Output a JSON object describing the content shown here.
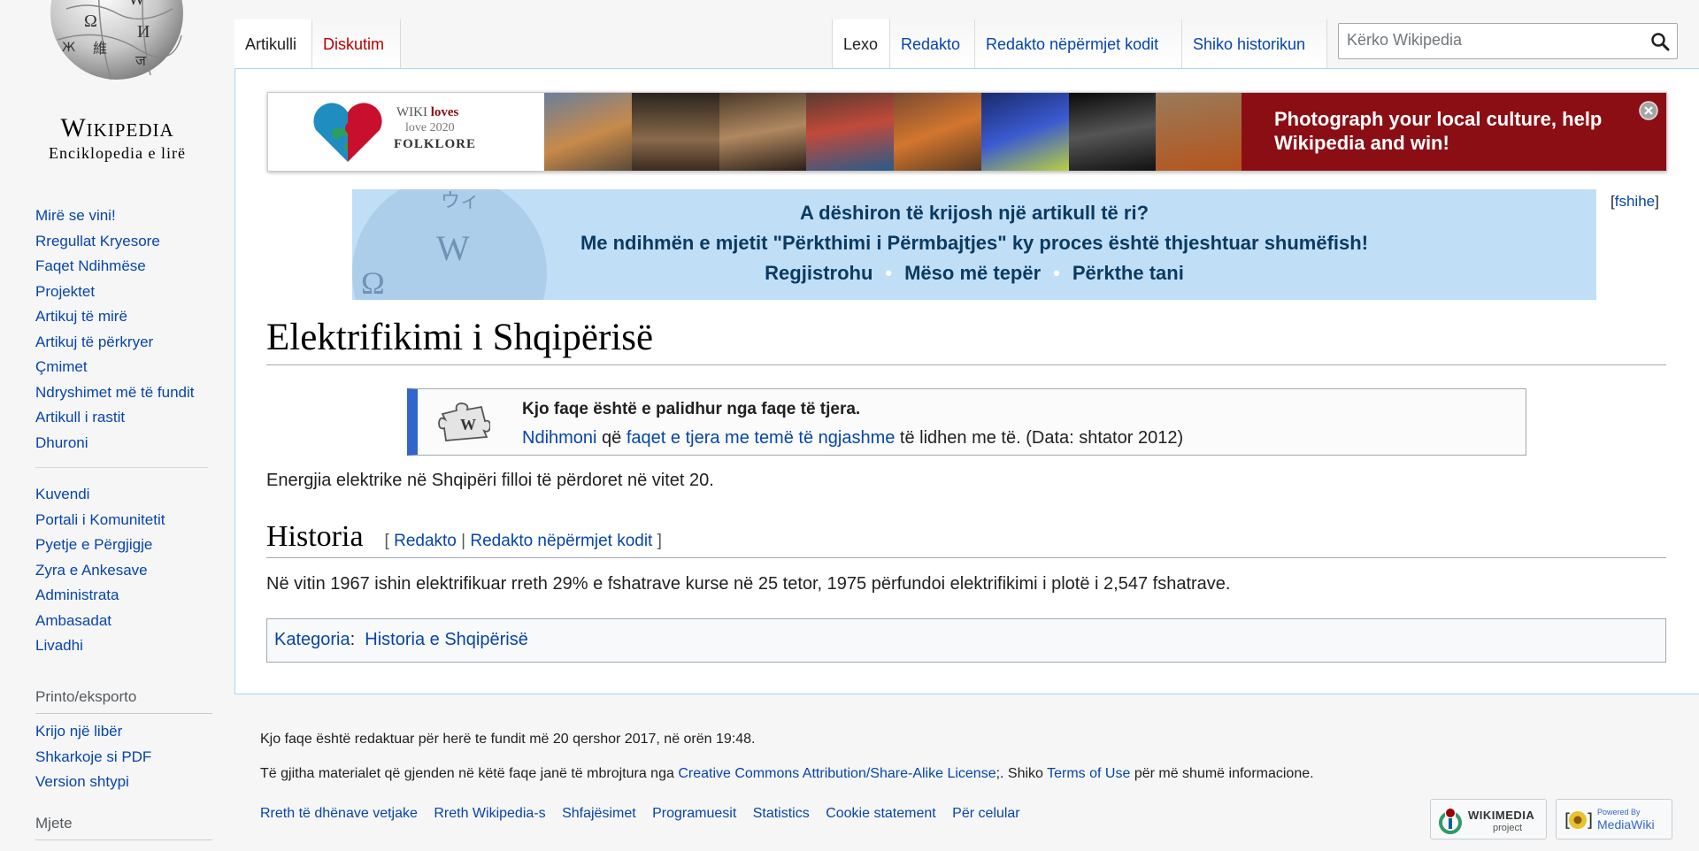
{
  "logo": {
    "wordmark": "Wikipedia",
    "tagline": "Enciklopedia e lirë"
  },
  "sidebar": {
    "nav": [
      "Mirë se vini!",
      "Rregullat Kryesore",
      "Faqet Ndihmëse",
      "Projektet",
      "Artikuj të mirë",
      "Artikuj të përkryer",
      "Çmimet",
      "Ndryshimet më të fundit",
      "Artikull i rastit",
      "Dhuroni"
    ],
    "community": [
      "Kuvendi",
      "Portali i Komunitetit",
      "Pyetje e Përgjigje",
      "Zyra e Ankesave",
      "Administrata",
      "Ambasadat",
      "Livadhi"
    ],
    "print_heading": "Printo/eksporto",
    "print": [
      "Krijo një libër",
      "Shkarkoje si PDF",
      "Version shtypi"
    ],
    "tools_heading": "Mjete"
  },
  "tabs": {
    "article": "Artikulli",
    "talk": "Diskutim",
    "read": "Lexo",
    "edit": "Redakto",
    "edit_source": "Redakto nëpërmjet kodit",
    "history": "Shiko historikun"
  },
  "search": {
    "placeholder": "Kërko Wikipedia"
  },
  "banner": {
    "wiki": "WIKI",
    "loves": "loves",
    "year": "love 2020",
    "folklore": "FOLKLORE",
    "line1": "Photograph your local culture, help",
    "line2": "Wikipedia and win!"
  },
  "cx": {
    "line1": "A dëshiron të krijosh një artikull të ri?",
    "line2": "Me ndihmën e mjetit \"Përkthimi i Përmbajtjes\" ky proces është thjeshtuar shumëfish!",
    "register": "Regjistrohu",
    "learn": "Mëso më tepër",
    "translate": "Përkthe tani",
    "hide": "fshihe"
  },
  "article": {
    "title": "Elektrifikimi i Shqipërisë",
    "orphan_title": "Kjo faqe është e palidhur nga faqe të tjera.",
    "orphan_help": "Ndihmoni",
    "orphan_mid": "që",
    "orphan_link": "faqet e tjera me temë të ngjashme",
    "orphan_end": "të lidhen me të. (Data: shtator 2012)",
    "intro": "Energjia elektrike në Shqipëri filloi të përdoret në vitet 20.",
    "section_title": "Historia",
    "section_edit": "Redakto",
    "section_edit_source": "Redakto nëpërmjet kodit",
    "history_text": "Në vitin 1967 ishin elektrifikuar rreth 29% e fshatrave kurse në 25 tetor, 1975 përfundoi elektrifikimi i plotë i 2,547 fshatrave.",
    "category_label": "Kategoria",
    "category": "Historia e Shqipërisë"
  },
  "footer": {
    "lastmod": "Kjo faqe është redaktuar për herë te fundit më 20 qershor 2017, në orën 19:48.",
    "license_pre": "Të gjitha materialet që gjenden në këtë faqe janë të mbrojtura nga",
    "license_link": "Creative Commons Attribution/Share-Alike License",
    "license_mid": ";. Shiko",
    "terms": "Terms of Use",
    "license_end": "për më shumë informacione.",
    "places": [
      "Rreth të dhënave vetjake",
      "Rreth Wikipedia-s",
      "Shfajësimet",
      "Programuesit",
      "Statistics",
      "Cookie statement",
      "Për celular"
    ],
    "wm_line1": "WIKIMEDIA",
    "wm_line2": "project",
    "mw_line1": "Powered By",
    "mw_line2": "MediaWiki"
  }
}
